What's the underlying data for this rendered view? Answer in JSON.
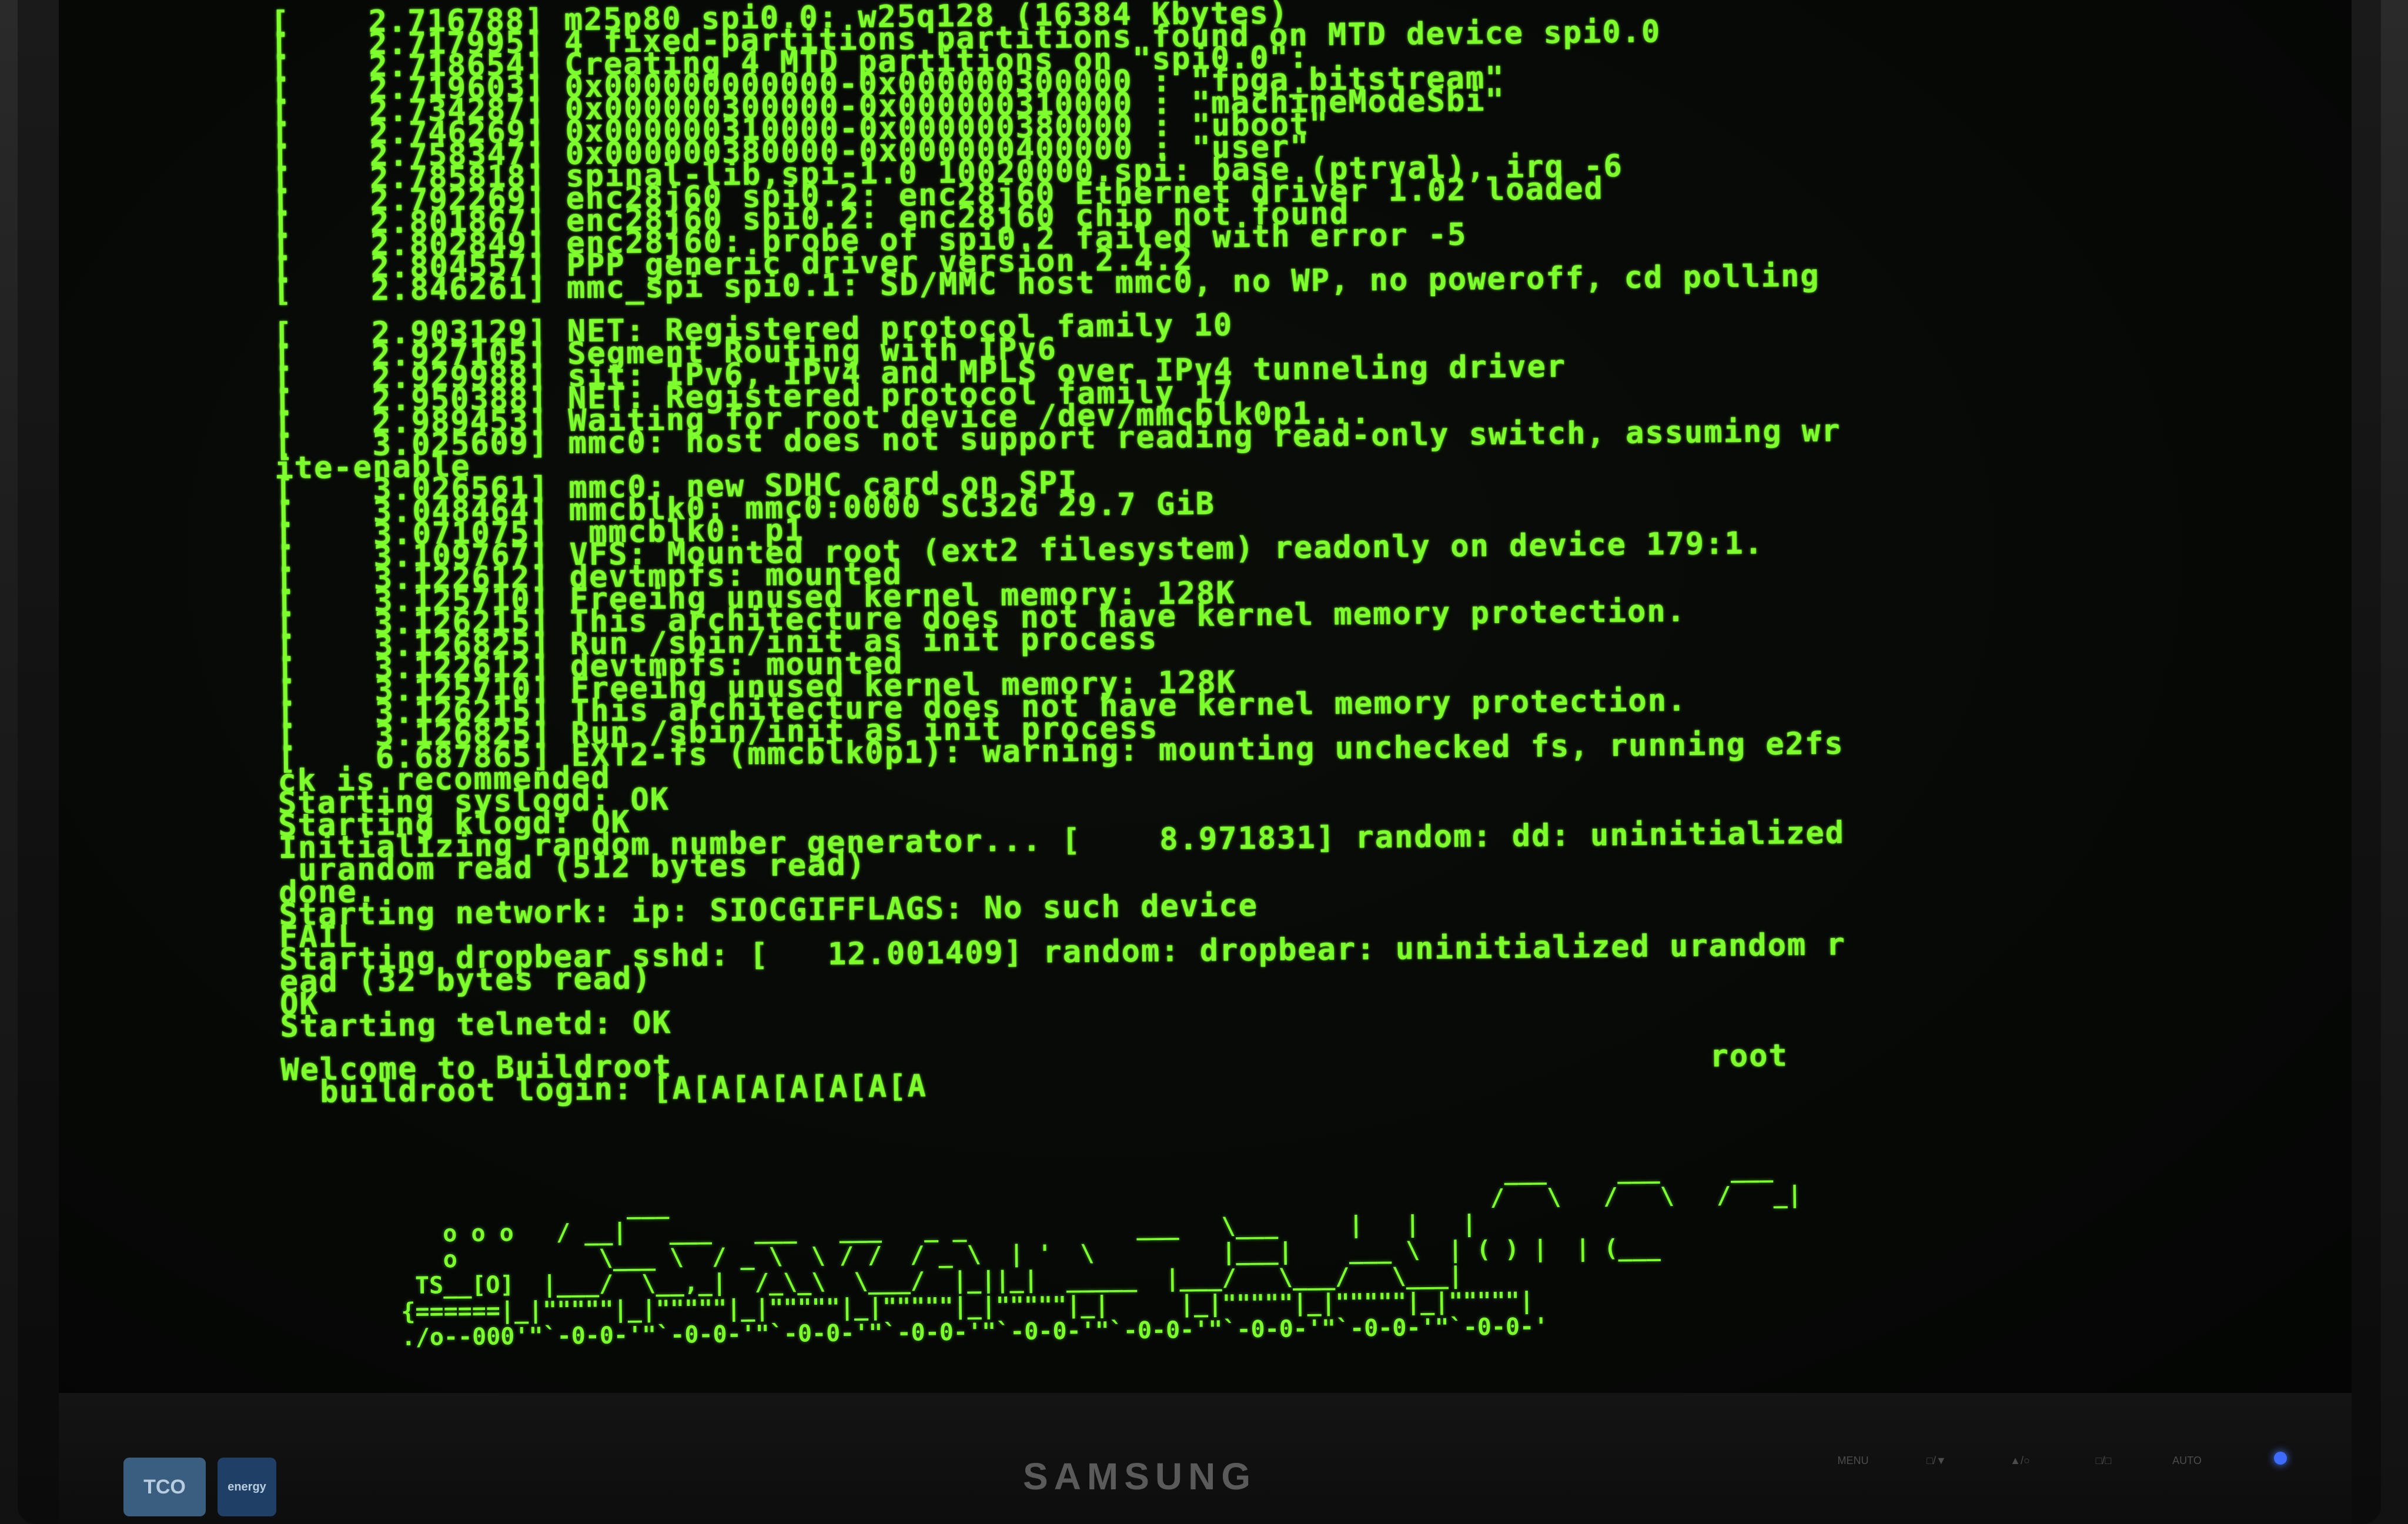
{
  "console": {
    "lines": [
      "[    2.716788] m25p80 spi0.0: w25q128 (16384 Kbytes)",
      "[    2.717995] 4 fixed-partitions partitions found on MTD device spi0.0",
      "[    2.718654] Creating 4 MTD partitions on \"spi0.0\":",
      "[    2.719603] 0x000000000000-0x000000300000 : \"fpga_bitstream\"",
      "[    2.734287] 0x000000300000-0x000000310000 : \"machineModeSbi\"",
      "[    2.746269] 0x000000310000-0x000000380000 : \"uboot\"",
      "[    2.758347] 0x000000380000-0x000000400000 : \"user\"",
      "[    2.785818] spinal-lib,spi-1.0 10020000.spi: base (ptrval), irq -6",
      "[    2.792269] enc28j60 spi0.2: enc28j60 Ethernet driver 1.02 loaded",
      "[    2.801867] enc28j60 spi0.2: enc28j60 chip not found",
      "[    2.802849] enc28j60: probe of spi0.2 failed with error -5",
      "[    2.804557] PPP generic driver version 2.4.2",
      "[    2.846261] mmc_spi spi0.1: SD/MMC host mmc0, no WP, no poweroff, cd polling",
      "",
      "[    2.903129] NET: Registered protocol family 10",
      "[    2.927105] Segment Routing with IPv6",
      "[    2.929988] sit: IPv6, IPv4 and MPLS over IPv4 tunneling driver",
      "[    2.950388] NET: Registered protocol family 17",
      "[    2.989453] Waiting for root device /dev/mmcblk0p1...",
      "[    3.025609] mmc0: host does not support reading read-only switch, assuming wr",
      "ite-enable",
      "[    3.026561] mmc0: new SDHC card on SPI",
      "[    3.048464] mmcblk0: mmc0:0000 SC32G 29.7 GiB",
      "[    3.071075]  mmcblk0: p1",
      "[    3.109767] VFS: Mounted root (ext2 filesystem) readonly on device 179:1.",
      "[    3.122612] devtmpfs: mounted",
      "[    3.125710] Freeing unused kernel memory: 128K",
      "[    3.126215] This architecture does not have kernel memory protection.",
      "[    3.126825] Run /sbin/init as init process",
      "[    3.122612] devtmpfs: mounted",
      "[    3.125710] Freeing unused kernel memory: 128K",
      "[    3.126215] This architecture does not have kernel memory protection.",
      "[    3.126825] Run /sbin/init as init process",
      "[    6.687865] EXT2-fs (mmcblk0p1): warning: mounting unchecked fs, running e2fs",
      "ck is recommended",
      "Starting syslogd: OK",
      "Starting klogd: OK",
      "Initializing random number generator... [    8.971831] random: dd: uninitialized",
      " urandom read (512 bytes read)",
      "done.",
      "Starting network: ip: SIOCGIFFLAGS: No such device",
      "FAIL",
      "Starting dropbear sshd: [   12.001409] random: dropbear: uninitialized urandom r",
      "ead (32 bytes read)",
      "OK",
      "Starting telnetd: OK",
      "",
      "Welcome to Buildroot                                                     root",
      "  buildroot login: [A[A[A[A[A[A[A"
    ]
  },
  "ascii_art": {
    "lines": [
      "                                                                              ___     ___     ___",
      "                ___                                                          /   \\   /   \\   /   _|",
      "   o o o   / __|   ___   ___   ___   _ _            ___   \\___     |   |   |",
      "   o          \\___ \\  / _ \\  \\ / /  / _ \\  | '  \\         |___|    ___ \\  | ( ) |  | (___",
      " TS__[O]  |___/  \\__,_|  /_\\_\\  \\___/  |_||_|  _____  |___/   \\___/   \\___|",
      "{======|_|\"\"\"\"\"|_|\"\"\"\"\"|_|\"\"\"\"\"|_|\"\"\"\"\"|_|\"\"\"\"\"|_|     |_|\"\"\"\"\"|_|\"\"\"\"\"|_|\"\"\"\"\"|",
      "./o--000'\"`-0-0-'\"`-0-0-'\"`-0-0-'\"`-0-0-'\"`-0-0-'\"`-0-0-'\"`-0-0-'\"`-0-0-'\"`-0-0-'"
    ]
  },
  "monitor": {
    "brand": "SAMSUNG",
    "buttons": [
      "MENU",
      "□/▼",
      "▲/○",
      "□/□",
      "AUTO"
    ],
    "stickers": [
      "TCO",
      "energy"
    ],
    "text_color": "#7dff2c"
  }
}
